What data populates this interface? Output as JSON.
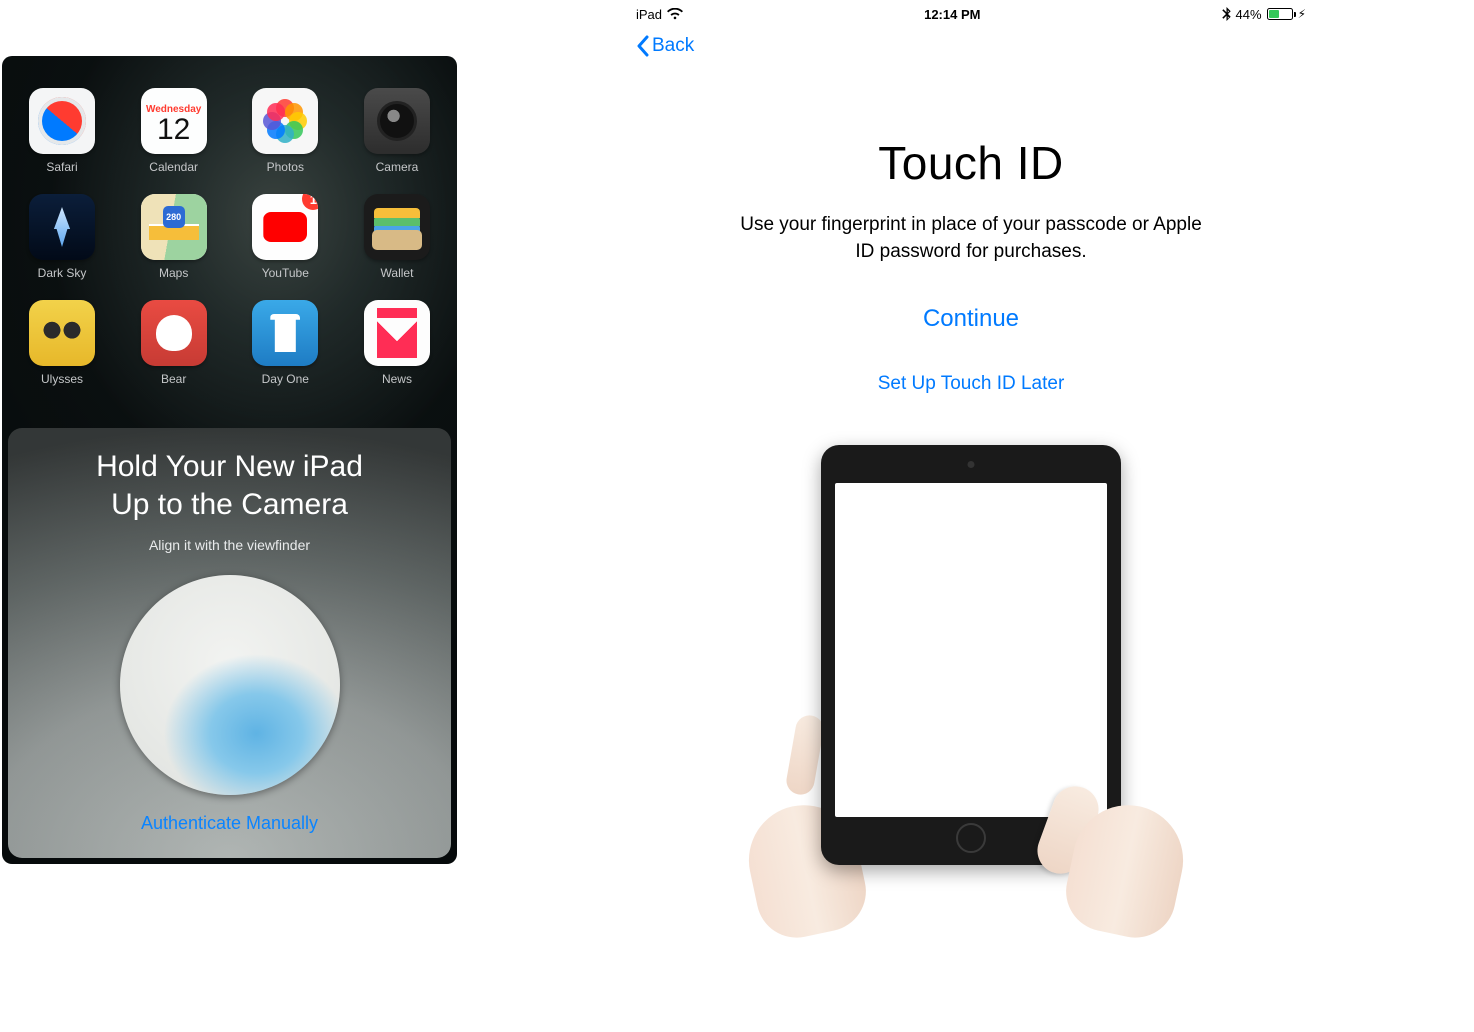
{
  "phone": {
    "apps": {
      "row1": [
        {
          "label": "Safari"
        },
        {
          "label": "Calendar",
          "weekday": "Wednesday",
          "day": "12"
        },
        {
          "label": "Photos"
        },
        {
          "label": "Camera"
        }
      ],
      "row2": [
        {
          "label": "Dark Sky"
        },
        {
          "label": "Maps",
          "shield": "280"
        },
        {
          "label": "YouTube",
          "badge": "1"
        },
        {
          "label": "Wallet"
        }
      ],
      "row3": [
        {
          "label": "Ulysses"
        },
        {
          "label": "Bear"
        },
        {
          "label": "Day One"
        },
        {
          "label": "News"
        }
      ]
    },
    "sheet": {
      "title_l1": "Hold Your New iPad",
      "title_l2": "Up to the Camera",
      "subtitle": "Align it with the viewfinder",
      "auth_link": "Authenticate Manually"
    }
  },
  "ipad": {
    "status": {
      "device": "iPad",
      "time": "12:14 PM",
      "battery_pct": "44%"
    },
    "nav": {
      "back": "Back"
    },
    "touchid": {
      "title": "Touch ID",
      "desc": "Use your fingerprint in place of your passcode or Apple ID password for purchases.",
      "continue": "Continue",
      "later": "Set Up Touch ID Later"
    }
  }
}
